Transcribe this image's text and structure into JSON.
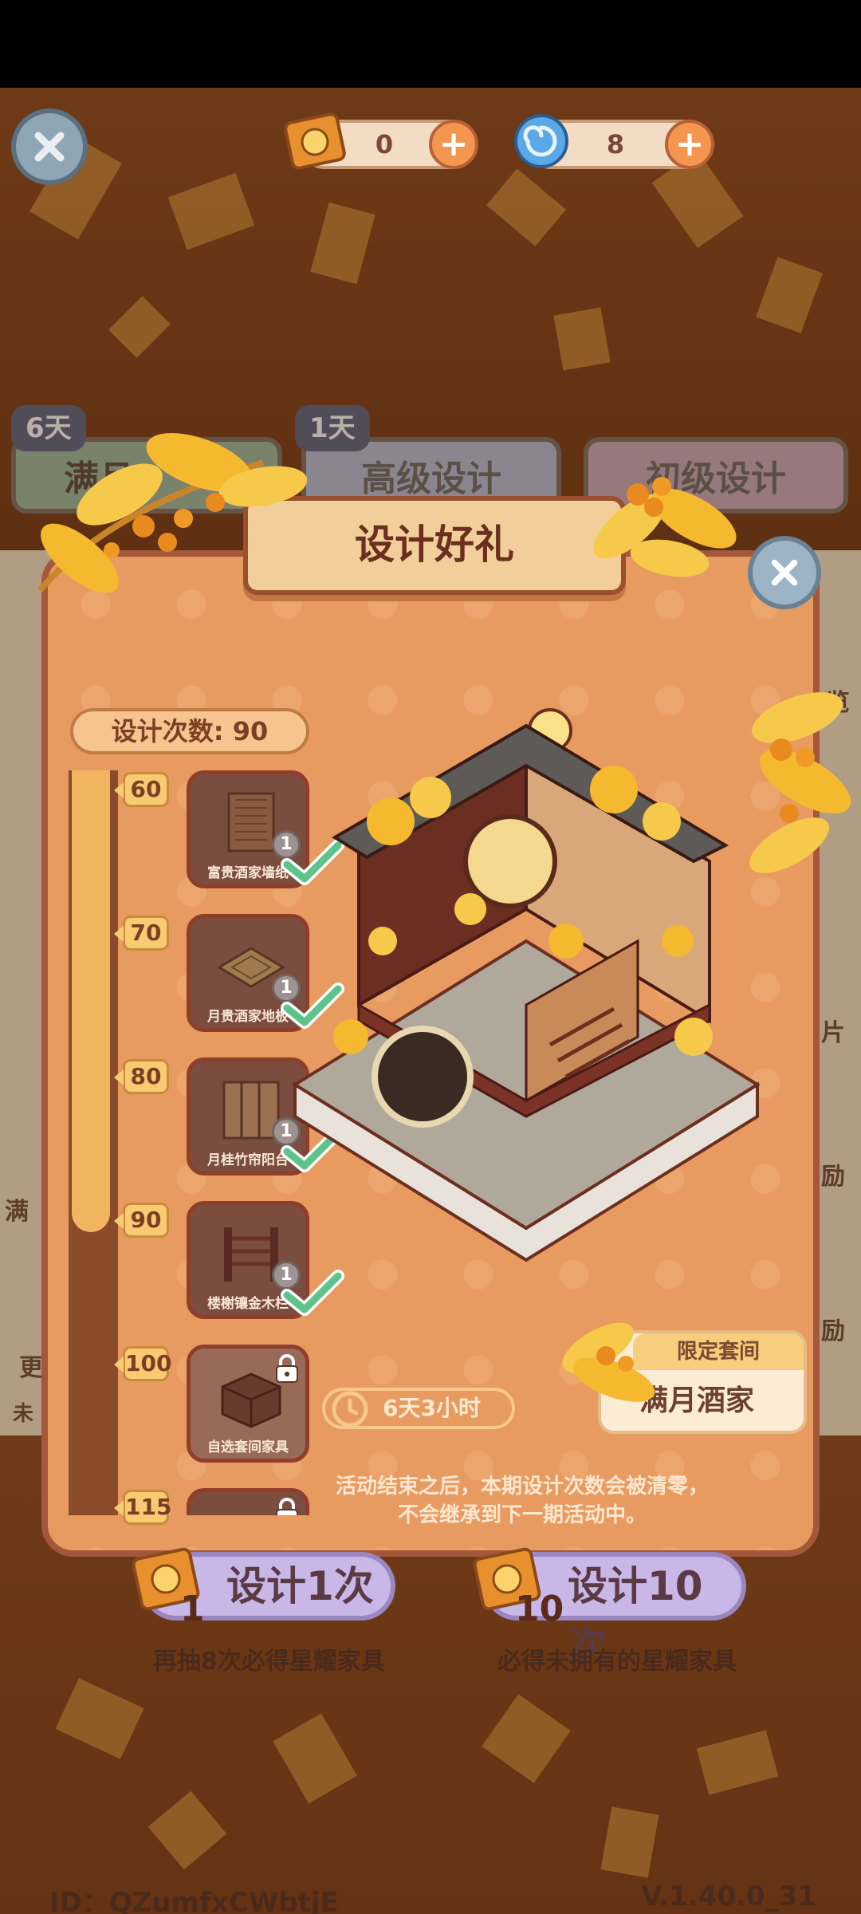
{
  "currencies": [
    {
      "icon": "ticket-icon",
      "value": "0"
    },
    {
      "icon": "swirl-gem-icon",
      "value": "8"
    }
  ],
  "tabs": [
    {
      "badge": "6天",
      "label": "满月"
    },
    {
      "badge": "1天",
      "label": "高级设计"
    },
    {
      "badge": "",
      "label": "初级设计"
    }
  ],
  "side_texts": [
    "览",
    "片",
    "励",
    "励",
    "满",
    "更",
    "未"
  ],
  "modal": {
    "title": "设计好礼",
    "count_label": "设计次数: 90",
    "tiers": [
      {
        "threshold": "60",
        "name": "富贵酒家墙纸",
        "qty": "1",
        "claimed": true
      },
      {
        "threshold": "70",
        "name": "月贵酒家地板",
        "qty": "1",
        "claimed": true
      },
      {
        "threshold": "80",
        "name": "月桂竹帘阳台",
        "qty": "1",
        "claimed": true
      },
      {
        "threshold": "90",
        "name": "楼榭镶金木栏",
        "qty": "1",
        "claimed": true
      },
      {
        "threshold": "100",
        "name": "自选套间家具",
        "qty": "",
        "claimed": false
      },
      {
        "threshold": "115",
        "name": "",
        "qty": "",
        "claimed": false
      }
    ],
    "progress_fraction": 0.62,
    "timer": "6天3小时",
    "suite_header": "限定套间",
    "suite_name": "满月酒家",
    "notice_line1": "活动结束之后，本期设计次数会被清零，",
    "notice_line2": "不会继承到下一期活动中。"
  },
  "draw_buttons": [
    {
      "label": "设计1次",
      "cost": "1",
      "subtitle": "再抽8次必得星耀家具"
    },
    {
      "label": "设计10次",
      "cost": "10",
      "subtitle": "必得未拥有的星耀家具"
    }
  ],
  "footer": {
    "id": "ID：QZumfxCWbtjE",
    "version": "V.1.40.0_31"
  },
  "colors": {
    "accent": "#f49650",
    "modal_bg": "#e79b61",
    "progress": "#f2b45e"
  }
}
